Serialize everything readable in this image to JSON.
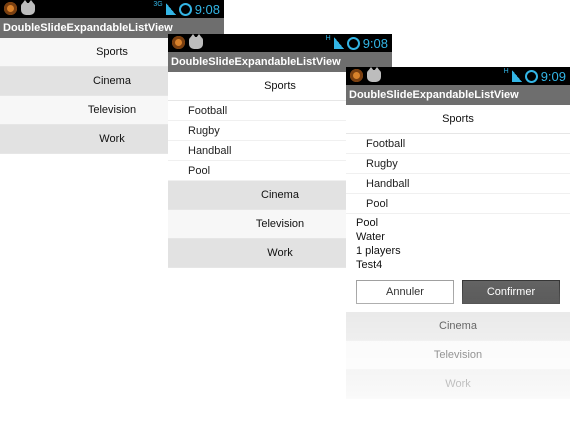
{
  "screens": [
    {
      "status": {
        "network": "3G",
        "time": "9:08"
      },
      "title": "DoubleSlideExpandableListView",
      "groups": [
        "Sports",
        "Cinema",
        "Television",
        "Work"
      ]
    },
    {
      "status": {
        "network": "H",
        "time": "9:08"
      },
      "title": "DoubleSlideExpandableListView",
      "expanded_group": "Sports",
      "children": [
        "Football",
        "Rugby",
        "Handball",
        "Pool"
      ],
      "other_groups": [
        "Cinema",
        "Television",
        "Work"
      ]
    },
    {
      "status": {
        "network": "H",
        "time": "9:09"
      },
      "title": "DoubleSlideExpandableListView",
      "expanded_group": "Sports",
      "children": [
        "Football",
        "Rugby",
        "Handball",
        "Pool"
      ],
      "detail_lines": [
        "Pool",
        "Water",
        "1 players",
        "Test4"
      ],
      "cancel_label": "Annuler",
      "confirm_label": "Confirmer",
      "other_groups": [
        "Cinema",
        "Television",
        "Work"
      ]
    }
  ]
}
